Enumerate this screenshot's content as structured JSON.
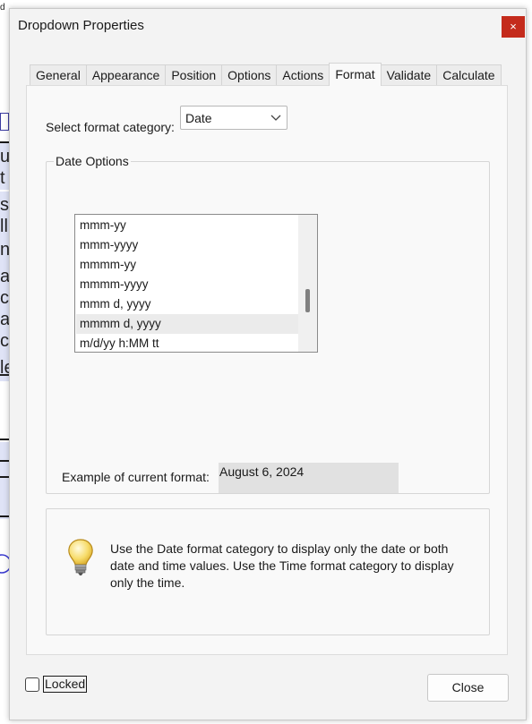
{
  "background_fragments": [
    "d",
    "ul",
    "t",
    "s",
    "lli",
    "n",
    "a",
    "c",
    "ag",
    "ch",
    "le"
  ],
  "dialog": {
    "title": "Dropdown Properties",
    "close_glyph": "×"
  },
  "tabs": [
    {
      "label": "General",
      "active": false
    },
    {
      "label": "Appearance",
      "active": false
    },
    {
      "label": "Position",
      "active": false
    },
    {
      "label": "Options",
      "active": false
    },
    {
      "label": "Actions",
      "active": false
    },
    {
      "label": "Format",
      "active": true
    },
    {
      "label": "Validate",
      "active": false
    },
    {
      "label": "Calculate",
      "active": false
    }
  ],
  "format": {
    "category_label": "Select format category:",
    "category_value": "Date",
    "date_options": {
      "legend": "Date Options",
      "items": [
        "mmm-yy",
        "mmm-yyyy",
        "mmmm-yy",
        "mmmm-yyyy",
        "mmm d, yyyy",
        "mmmm d, yyyy",
        "m/d/yy h:MM tt"
      ],
      "selected_index": 5
    },
    "example_label": "Example of current format:",
    "example_value": "August 6, 2024"
  },
  "tip": {
    "icon": "lightbulb-icon",
    "text": "Use the Date format category to display only the date or both date and time values. Use the Time format category to display only the time."
  },
  "footer": {
    "locked_label": "Locked",
    "locked_checked": false,
    "close_label": "Close"
  },
  "colors": {
    "close_x_bg": "#c42b1c",
    "selected_row_bg": "#ebebeb",
    "example_bg": "#e1e1e1"
  }
}
